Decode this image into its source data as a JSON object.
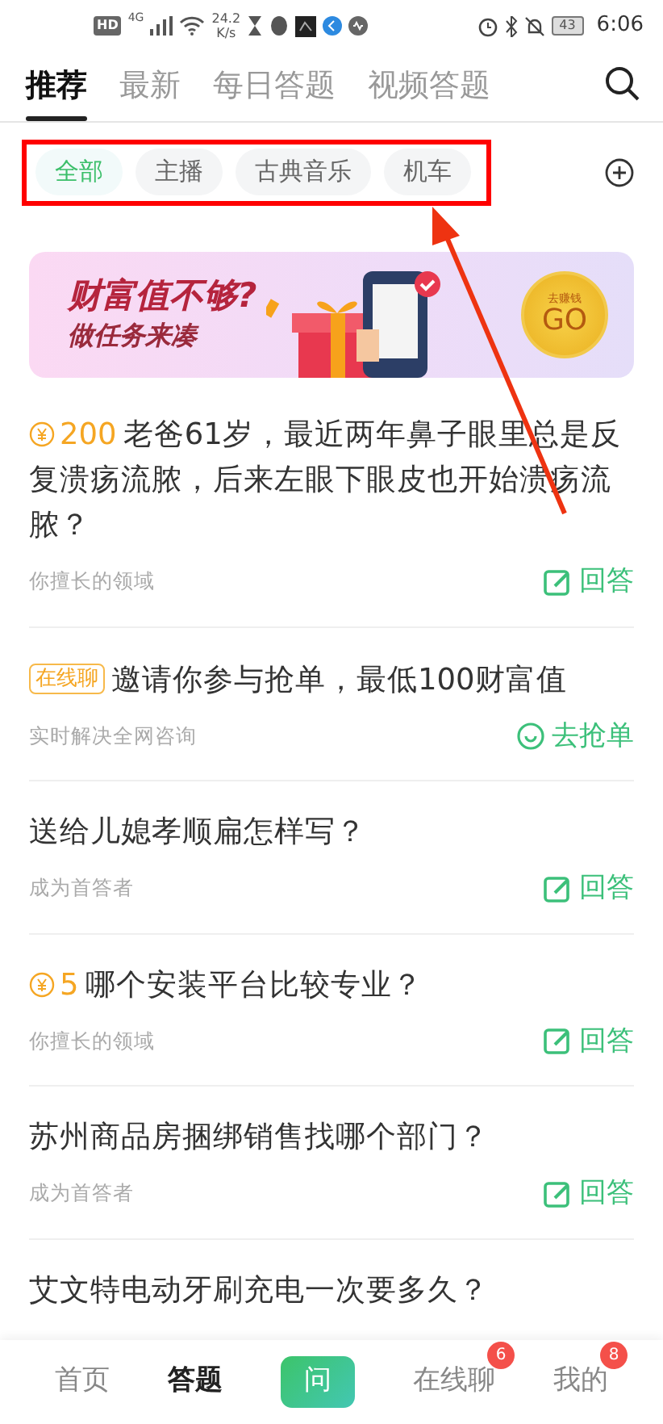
{
  "status_bar": {
    "hd": "HD",
    "network": "4G",
    "speed_value": "24.2",
    "speed_unit": "K/s",
    "battery": "43",
    "time": "6:06"
  },
  "tabs": [
    {
      "label": "推荐",
      "selected": true
    },
    {
      "label": "最新",
      "selected": false
    },
    {
      "label": "每日答题",
      "selected": false
    },
    {
      "label": "视频答题",
      "selected": false
    }
  ],
  "categories": [
    {
      "label": "全部",
      "selected": true
    },
    {
      "label": "主播",
      "selected": false
    },
    {
      "label": "古典音乐",
      "selected": false
    },
    {
      "label": "机车",
      "selected": false
    }
  ],
  "banner": {
    "title": "财富值不够?",
    "subtitle": "做任务来凑",
    "coin_caption": "去赚钱",
    "coin_label": "GO"
  },
  "questions": [
    {
      "kind": "reward",
      "reward": "200",
      "title": "老爸61岁，最近两年鼻子眼里总是反复溃疡流脓，后来左眼下眼皮也开始溃疡流脓？",
      "meta": "你擅长的领域",
      "action": {
        "label": "回答",
        "kind": "answer"
      }
    },
    {
      "kind": "tag",
      "tag": "在线聊",
      "title": "邀请你参与抢单，最低100财富值",
      "meta": "实时解决全网咨询",
      "action": {
        "label": "去抢单",
        "kind": "grab"
      }
    },
    {
      "kind": "plain",
      "title": "送给儿媳孝顺扁怎样写？",
      "meta": "成为首答者",
      "action": {
        "label": "回答",
        "kind": "answer"
      }
    },
    {
      "kind": "reward",
      "reward": "5",
      "title": "哪个安装平台比较专业？",
      "meta": "你擅长的领域",
      "action": {
        "label": "回答",
        "kind": "answer"
      }
    },
    {
      "kind": "plain",
      "title": "苏州商品房捆绑销售找哪个部门？",
      "meta": "成为首答者",
      "action": {
        "label": "回答",
        "kind": "answer"
      }
    },
    {
      "kind": "plain",
      "title": "艾文特电动牙刷充电一次要多久？"
    }
  ],
  "bottom_nav": [
    {
      "label": "首页",
      "selected": false,
      "kind": "text"
    },
    {
      "label": "答题",
      "selected": true,
      "kind": "text"
    },
    {
      "label": "问",
      "selected": false,
      "kind": "ask"
    },
    {
      "label": "在线聊",
      "selected": false,
      "kind": "text",
      "badge": "6"
    },
    {
      "label": "我的",
      "selected": false,
      "kind": "text",
      "badge": "8"
    }
  ]
}
